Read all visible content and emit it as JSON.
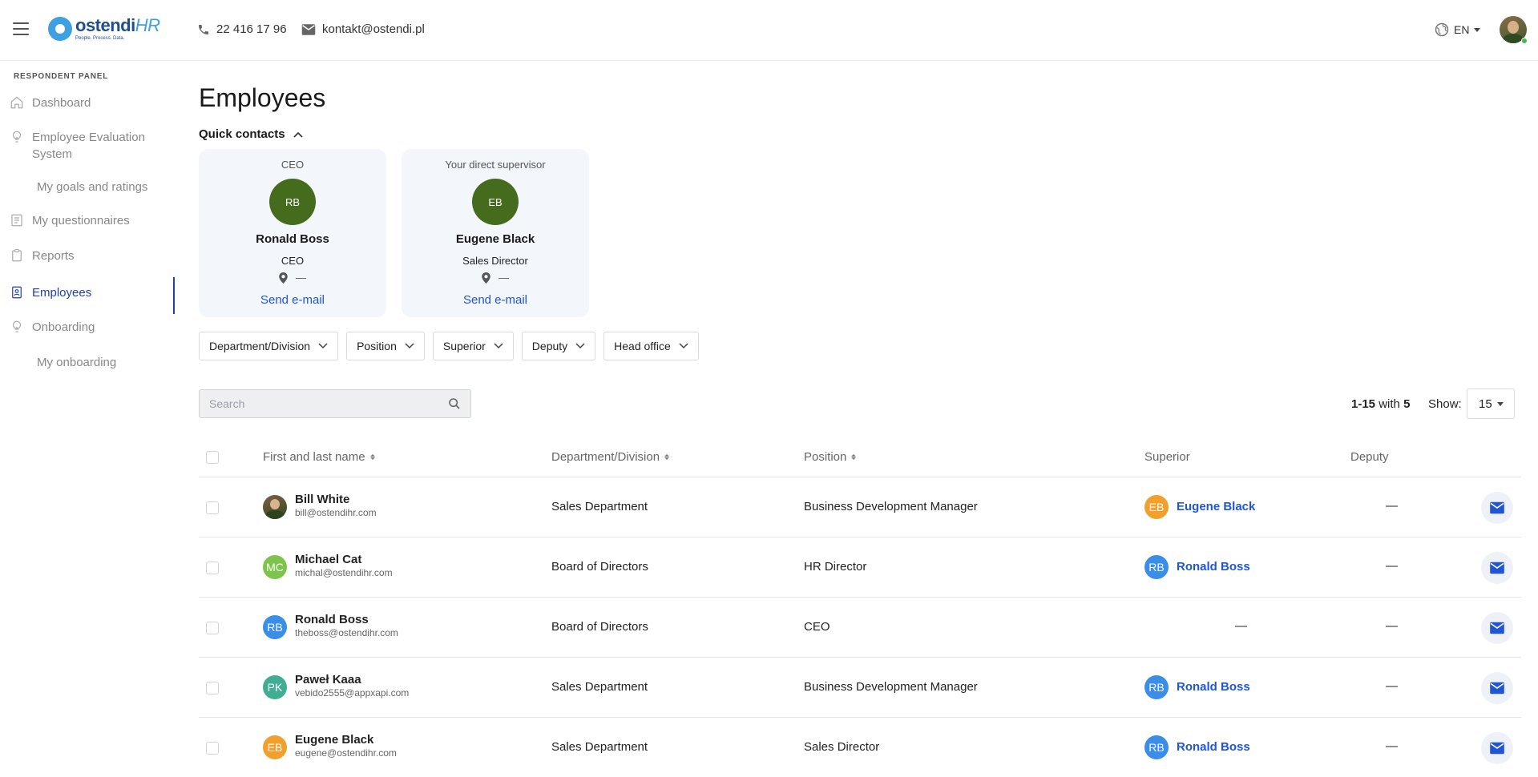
{
  "header": {
    "logo_main": "ostendi",
    "logo_script": "HR",
    "logo_tagline": "People. Process. Data.",
    "phone": "22 416 17 96",
    "email": "kontakt@ostendi.pl",
    "language": "EN"
  },
  "sidebar": {
    "panel_title": "RESPONDENT PANEL",
    "items": [
      {
        "label": "Dashboard",
        "icon": "home-icon"
      },
      {
        "label": "Employee Evaluation",
        "label2": "System",
        "icon": "lightbulb-icon"
      },
      {
        "label": "My goals and ratings"
      },
      {
        "label": "My questionnaires",
        "icon": "questionnaire-icon"
      },
      {
        "label": "Reports",
        "icon": "clipboard-icon"
      },
      {
        "label": "Employees",
        "icon": "employee-badge-icon",
        "active": true
      },
      {
        "label": "Onboarding",
        "icon": "lightbulb-icon"
      },
      {
        "label": "My onboarding"
      }
    ]
  },
  "main": {
    "title": "Employees",
    "quick_contacts_label": "Quick contacts",
    "quick_contacts": [
      {
        "role": "CEO",
        "initials": "RB",
        "name": "Ronald Boss",
        "position": "CEO",
        "location": "—",
        "action": "Send e-mail"
      },
      {
        "role": "Your direct supervisor",
        "initials": "EB",
        "name": "Eugene Black",
        "position": "Sales Director",
        "location": "—",
        "action": "Send e-mail"
      }
    ],
    "filters": [
      "Department/Division",
      "Position",
      "Superior",
      "Deputy",
      "Head office"
    ],
    "search": {
      "placeholder": "Search",
      "value": ""
    },
    "pager": {
      "range": "1-15",
      "with_label": "with",
      "total": "5"
    },
    "show": {
      "label": "Show:",
      "value": "15"
    }
  },
  "table": {
    "columns": {
      "name": "First and last name",
      "department": "Department/Division",
      "position": "Position",
      "superior": "Superior",
      "deputy": "Deputy"
    },
    "rows": [
      {
        "name": "Bill White",
        "email": "bill@ostendihr.com",
        "initials": "",
        "photo": true,
        "avatar_color": "",
        "department": "Sales Department",
        "position": "Business Development Manager",
        "superior_initials": "EB",
        "superior_name": "Eugene Black",
        "superior_color": "#f0a02b",
        "deputy": "—"
      },
      {
        "name": "Michael Cat",
        "email": "michal@ostendihr.com",
        "initials": "MC",
        "photo": false,
        "avatar_color": "#7cc44b",
        "department": "Board of Directors",
        "position": "HR Director",
        "superior_initials": "RB",
        "superior_name": "Ronald Boss",
        "superior_color": "#3b8ee8",
        "deputy": "—"
      },
      {
        "name": "Ronald Boss",
        "email": "theboss@ostendihr.com",
        "initials": "RB",
        "photo": false,
        "avatar_color": "#3b8ee8",
        "department": "Board of Directors",
        "position": "CEO",
        "superior_initials": "",
        "superior_name": "",
        "superior_color": "",
        "superior_empty": "—",
        "deputy": "—"
      },
      {
        "name": "Paweł Kaaa",
        "email": "vebido2555@appxapi.com",
        "initials": "PK",
        "photo": false,
        "avatar_color": "#3fae93",
        "department": "Sales Department",
        "position": "Business Development Manager",
        "superior_initials": "RB",
        "superior_name": "Ronald Boss",
        "superior_color": "#3b8ee8",
        "deputy": "—"
      },
      {
        "name": "Eugene Black",
        "email": "eugene@ostendihr.com",
        "initials": "EB",
        "photo": false,
        "avatar_color": "#f0a02b",
        "department": "Sales Department",
        "position": "Sales Director",
        "superior_initials": "RB",
        "superior_name": "Ronald Boss",
        "superior_color": "#3b8ee8",
        "deputy": "—"
      }
    ]
  },
  "colors": {
    "accent": "#1f55d6",
    "active_nav": "#1f3fb5",
    "card_bg": "#f3f6fb",
    "quick_avatar": "#456b1d"
  }
}
